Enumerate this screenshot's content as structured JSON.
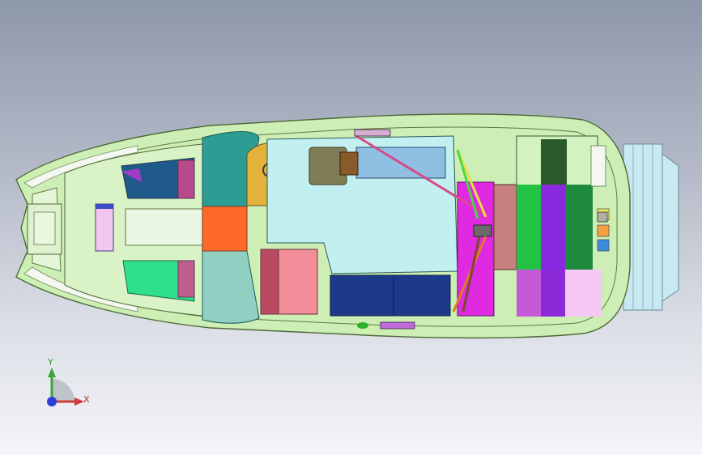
{
  "triad": {
    "x_label": "X",
    "y_label": "Y",
    "x_color": "#d23a3a",
    "y_color": "#3aa63a",
    "z_color": "#2b3fd8"
  },
  "model": {
    "hull_color": "#cdeeb4",
    "deck_color": "#d9f3c6",
    "cockpit_floor_color": "#c2f0f0",
    "swim_platform_color": "#c9e9f2"
  }
}
